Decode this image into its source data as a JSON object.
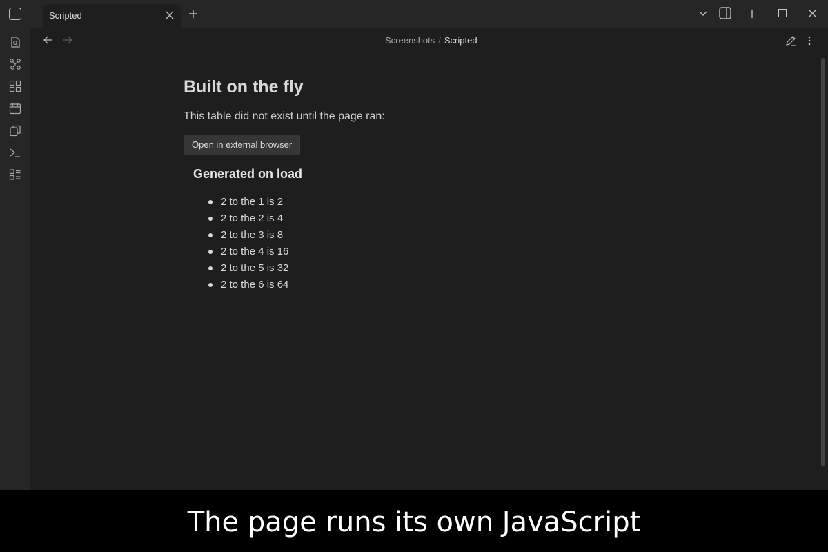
{
  "window": {
    "tab_title": "Scripted",
    "icons": {
      "sidebar_toggle": "sidebar-toggle-icon",
      "tab_close": "close-icon",
      "new_tab": "plus-icon",
      "tab_list": "chevron-down-icon",
      "split": "split-pane-icon",
      "minimize": "minimize-icon",
      "maximize": "maximize-icon",
      "close": "close-icon"
    }
  },
  "ribbon": {
    "items": [
      "file-search-icon",
      "graph-icon",
      "canvas-icon",
      "calendar-icon",
      "copy-icon",
      "terminal-icon",
      "outline-icon"
    ]
  },
  "breadcrumb": {
    "parent": "Screenshots",
    "separator": "/",
    "current": "Scripted"
  },
  "note": {
    "title": "Built on the fly",
    "intro": "This table did not exist until the page ran:",
    "button_label": "Open in external browser",
    "generated_heading": "Generated on load",
    "items": [
      "2 to the 1 is 2",
      "2 to the 2 is 4",
      "2 to the 3 is 8",
      "2 to the 4 is 16",
      "2 to the 5 is 32",
      "2 to the 6 is 64"
    ]
  },
  "caption": "The page runs its own JavaScript",
  "colors": {
    "titlebar_bg": "#262626",
    "content_bg": "#1e1e1e",
    "text": "#dadada",
    "caption_bg": "#000000"
  }
}
